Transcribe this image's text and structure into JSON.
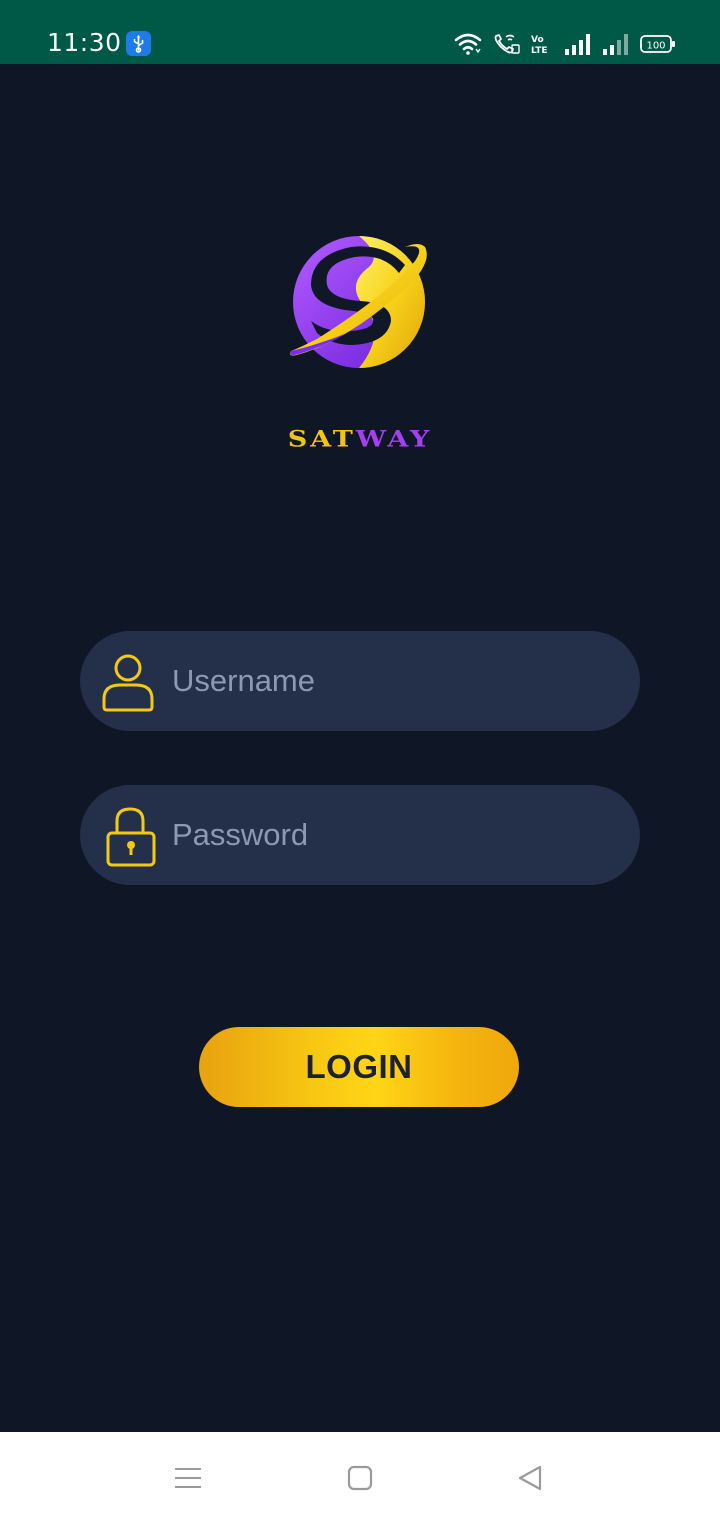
{
  "status_bar": {
    "time": "11:30",
    "battery": "100",
    "network_label": "Vo LTE"
  },
  "brand": {
    "name_part1": "SAT",
    "name_part2": "WAY",
    "colors": {
      "gold": "#f3c60e",
      "purple": "#a53ff0"
    }
  },
  "login_form": {
    "username": {
      "placeholder": "Username",
      "value": "",
      "icon": "user-icon"
    },
    "password": {
      "placeholder": "Password",
      "value": "",
      "icon": "lock-icon"
    },
    "submit_label": "LOGIN"
  },
  "nav_bar": {
    "menu_icon": "menu-icon",
    "home_icon": "home-icon",
    "back_icon": "back-icon"
  },
  "colors": {
    "background": "#0f1726",
    "status_bar": "#005847",
    "field_background": "#24304a",
    "accent": "#f7c612"
  }
}
